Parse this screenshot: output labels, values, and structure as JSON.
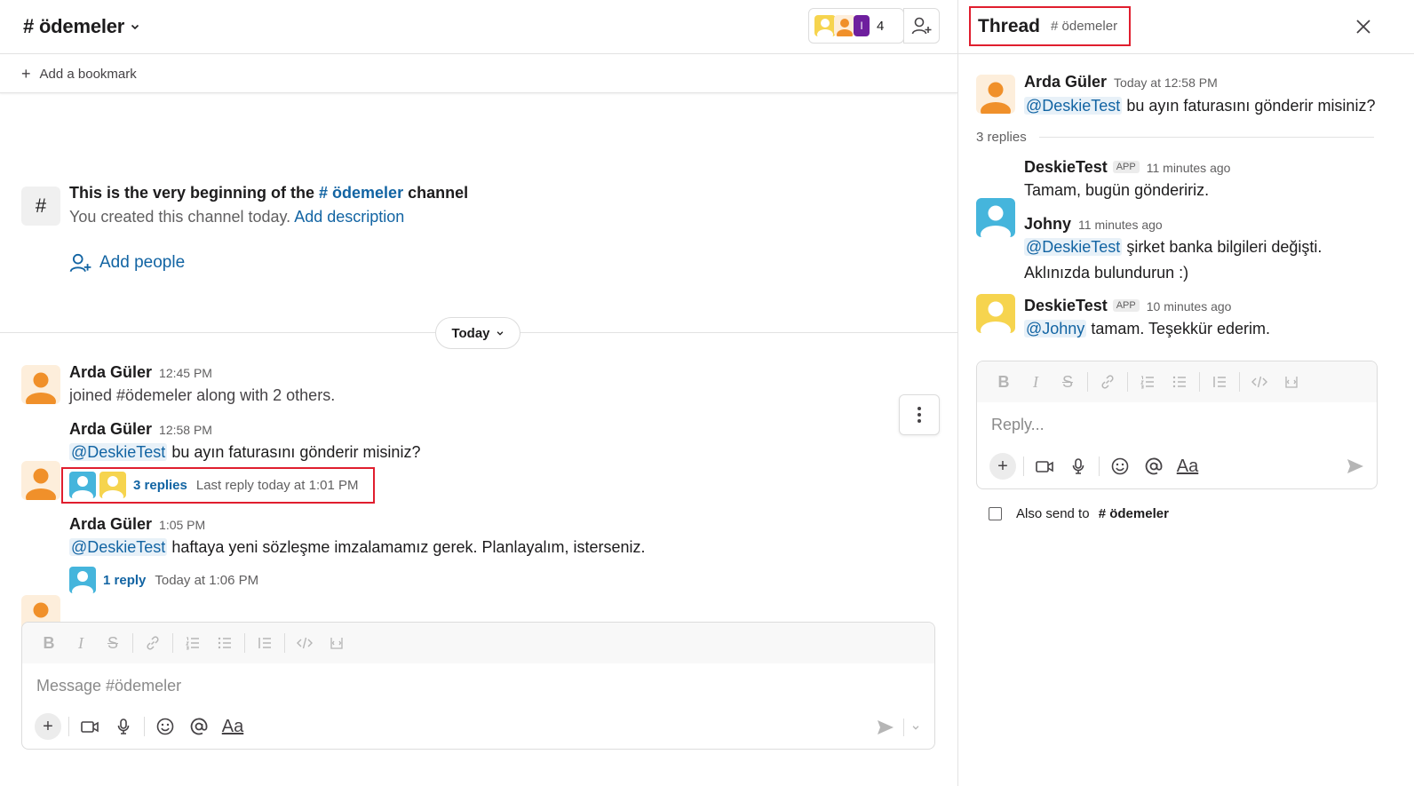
{
  "channel": {
    "name": "# ödemeler",
    "member_count": "4",
    "bookmark_label": "Add a bookmark"
  },
  "intro": {
    "title_prefix": "This is the very beginning of the ",
    "channel_link": "# ödemeler",
    "title_suffix": " channel",
    "subtitle": "You created this channel today.",
    "add_description": "Add description",
    "add_people": "Add people"
  },
  "date_divider": "Today",
  "messages": [
    {
      "author": "Arda Güler",
      "time": "12:45 PM",
      "text": "joined #ödemeler along with 2 others."
    },
    {
      "author": "Arda Güler",
      "time": "12:58 PM",
      "mention": "@DeskieTest",
      "text": " bu ayın faturasını gönderir misiniz?",
      "replies": "3 replies",
      "last_reply": "Last reply today at 1:01 PM"
    },
    {
      "author": "Arda Güler",
      "time": "1:05 PM",
      "mention": "@DeskieTest",
      "text": " haftaya yeni sözleşme imzalamamız gerek. Planlayalım, isterseniz.",
      "replies": "1 reply",
      "last_reply": "Today at 1:06 PM"
    }
  ],
  "composer": {
    "placeholder": "Message #ödemeler",
    "format_label": "Aa"
  },
  "thread": {
    "title": "Thread",
    "channel": "# ödemeler",
    "parent": {
      "author": "Arda Güler",
      "time": "Today at 12:58 PM",
      "mention": "@DeskieTest",
      "text": " bu ayın faturasını gönderir misiniz?"
    },
    "reply_count": "3 replies",
    "replies": [
      {
        "author": "DeskieTest",
        "badge": "APP",
        "time": "11 minutes ago",
        "text": "Tamam, bugün göndeririz."
      },
      {
        "author": "Johny",
        "time": "11 minutes ago",
        "mention": "@DeskieTest",
        "text": " şirket banka bilgileri değişti.",
        "text2": "Aklınızda bulundurun :)"
      },
      {
        "author": "DeskieTest",
        "badge": "APP",
        "time": "10 minutes ago",
        "mention": "@Johny",
        "text": " tamam. Teşekkür ederim."
      }
    ],
    "reply_placeholder": "Reply...",
    "format_label": "Aa",
    "also_send_prefix": "Also send to ",
    "also_send_channel": "# ödemeler"
  },
  "colors": {
    "link": "#1264a3",
    "highlight": "#e01e2e",
    "avatar_orange_bg": "#fdeedb",
    "avatar_orange_fg": "#f0902a",
    "avatar_blue_bg": "#45b5dc",
    "avatar_yellow_bg": "#f6d44e",
    "avatar_purple": "#6e1f9e"
  }
}
